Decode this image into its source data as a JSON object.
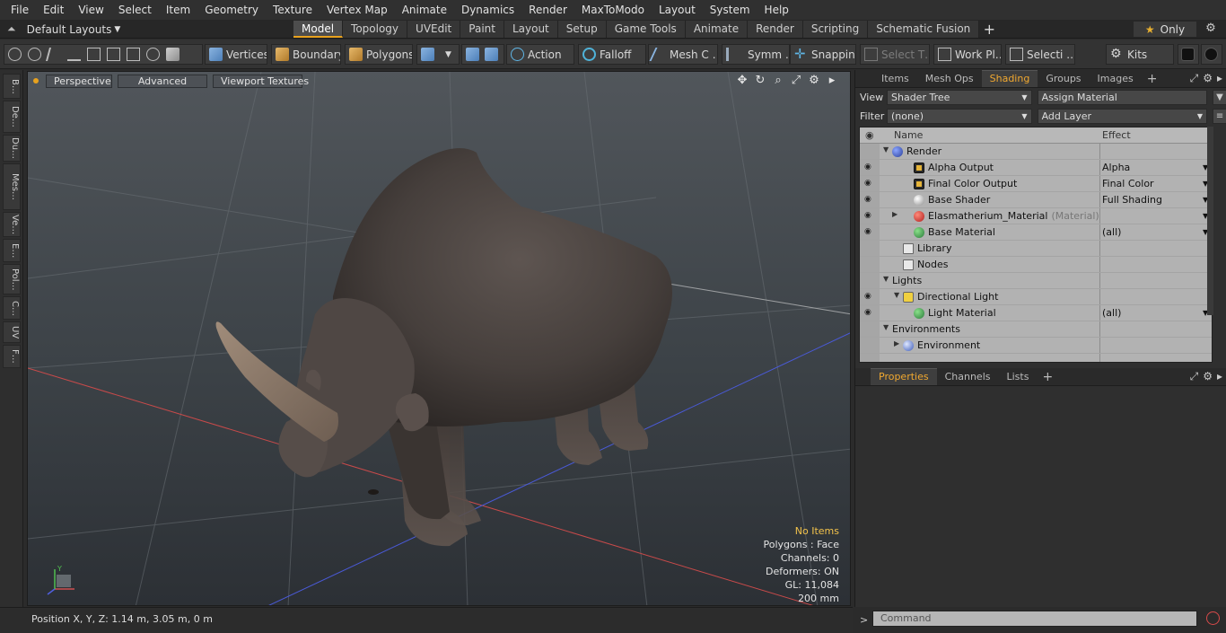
{
  "menu": [
    "File",
    "Edit",
    "View",
    "Select",
    "Item",
    "Geometry",
    "Texture",
    "Vertex Map",
    "Animate",
    "Dynamics",
    "Render",
    "MaxToModo",
    "Layout",
    "System",
    "Help"
  ],
  "layout_selector": "Default Layouts",
  "tabs": [
    {
      "label": "Model",
      "active": true
    },
    {
      "label": "Topology",
      "active": false
    },
    {
      "label": "UVEdit",
      "active": false
    },
    {
      "label": "Paint",
      "active": false
    },
    {
      "label": "Layout",
      "active": false
    },
    {
      "label": "Setup",
      "active": false
    },
    {
      "label": "Game Tools",
      "active": false
    },
    {
      "label": "Animate",
      "active": false
    },
    {
      "label": "Render",
      "active": false
    },
    {
      "label": "Scripting",
      "active": false
    },
    {
      "label": "Schematic Fusion",
      "active": false
    }
  ],
  "tab_add": "+",
  "only_button": {
    "star": "★",
    "label": "Only"
  },
  "toolbar": {
    "vertices": "Vertices",
    "boundary": "Boundary",
    "polygons": "Polygons",
    "action": "Action",
    "falloff": "Falloff",
    "mesh": "Mesh C …",
    "symmetry": "Symm …",
    "snapping": "Snapping",
    "select_t": "Select T…",
    "work_plane": "Work Pl…",
    "selection": "Selecti …",
    "kits": "Kits"
  },
  "left_tabs": [
    "B…",
    "De…",
    "Du…",
    "Mes…",
    "Ve…",
    "E…",
    "Pol…",
    "C…",
    "UV",
    "F…"
  ],
  "viewport": {
    "view_mode": "Perspective",
    "advanced": "Advanced",
    "textures": "Viewport Textures",
    "info": {
      "selection": "No Items",
      "polygons": "Polygons : Face",
      "channels": "Channels: 0",
      "deformers": "Deformers: ON",
      "gl": "GL: 11,084",
      "scale": "200 mm"
    },
    "axis_labels": {
      "x": "X",
      "y": "Y"
    }
  },
  "status": {
    "position": "Position X, Y, Z:   1.14 m, 3.05 m, 0 m"
  },
  "right_panel": {
    "tabs": [
      {
        "label": "Items",
        "active": false
      },
      {
        "label": "Mesh Ops",
        "active": false
      },
      {
        "label": "Shading",
        "active": true
      },
      {
        "label": "Groups",
        "active": false
      },
      {
        "label": "Images",
        "active": false
      }
    ],
    "view_label": "View",
    "view_value": "Shader Tree",
    "assign_material": "Assign Material",
    "filter_label": "Filter",
    "filter_value": "(none)",
    "add_layer": "Add Layer",
    "columns": {
      "name": "Name",
      "effect": "Effect"
    },
    "tree": [
      {
        "name": "Render",
        "sub": "",
        "effect": "",
        "icon": "ic-blue",
        "depth": 0,
        "twisty": "▼",
        "eye": false
      },
      {
        "name": "Alpha Output",
        "sub": "",
        "effect": "Alpha",
        "icon": "ic-img",
        "depth": 2,
        "twisty": "",
        "eye": true
      },
      {
        "name": "Final Color Output",
        "sub": "",
        "effect": "Final Color",
        "icon": "ic-img",
        "depth": 2,
        "twisty": "",
        "eye": true
      },
      {
        "name": "Base Shader",
        "sub": "",
        "effect": "Full Shading",
        "icon": "ic-white",
        "depth": 2,
        "twisty": "",
        "eye": true
      },
      {
        "name": "Elasmatherium_Material",
        "sub": "(Material)",
        "effect": "",
        "icon": "ic-red",
        "depth": 2,
        "twisty": "▶",
        "eye": true
      },
      {
        "name": "Base Material",
        "sub": "",
        "effect": "(all)",
        "icon": "ic-green",
        "depth": 2,
        "twisty": "",
        "eye": true
      },
      {
        "name": "Library",
        "sub": "",
        "effect": "",
        "icon": "ic-fold",
        "depth": 1,
        "twisty": "",
        "eye": false
      },
      {
        "name": "Nodes",
        "sub": "",
        "effect": "",
        "icon": "ic-fold",
        "depth": 1,
        "twisty": "",
        "eye": false
      },
      {
        "name": "Lights",
        "sub": "",
        "effect": "",
        "icon": "",
        "depth": 0,
        "twisty": "▼",
        "eye": false
      },
      {
        "name": "Directional Light",
        "sub": "",
        "effect": "",
        "icon": "ic-light",
        "depth": 1,
        "twisty": "▼",
        "eye": true
      },
      {
        "name": "Light Material",
        "sub": "",
        "effect": "(all)",
        "icon": "ic-green",
        "depth": 2,
        "twisty": "",
        "eye": true
      },
      {
        "name": "Environments",
        "sub": "",
        "effect": "",
        "icon": "",
        "depth": 0,
        "twisty": "▼",
        "eye": false
      },
      {
        "name": "Environment",
        "sub": "",
        "effect": "",
        "icon": "ic-env",
        "depth": 1,
        "twisty": "▶",
        "eye": false
      }
    ],
    "properties_tabs": [
      {
        "label": "Properties",
        "active": true
      },
      {
        "label": "Channels",
        "active": false
      },
      {
        "label": "Lists",
        "active": false
      }
    ],
    "command_placeholder": "Command",
    "command_caret": ">"
  }
}
